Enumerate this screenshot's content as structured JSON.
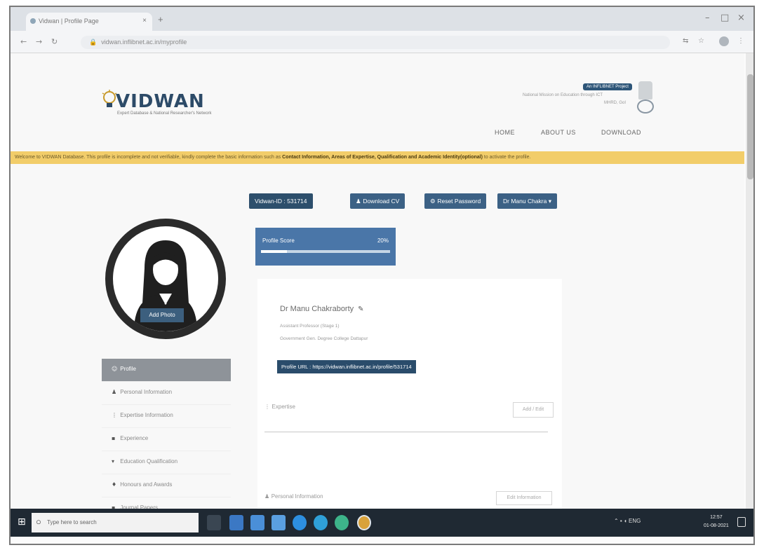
{
  "browser": {
    "tab_title": "Vidwan | Profile Page",
    "url": "vidwan.inflibnet.ac.in/myprofile",
    "win_controls": [
      "–",
      "□",
      "×"
    ],
    "nav_icons": [
      "back-icon",
      "forward-icon",
      "reload-icon",
      "lock-icon"
    ]
  },
  "header": {
    "logo_name": "VIDWAN",
    "logo_tagline": "Expert Database & National Researcher's Network",
    "badge": "An INFLIBNET Project",
    "gov_text": "National Mission on Education through ICT",
    "gov_text2": "MHRD, GoI",
    "nav": [
      "HOME",
      "ABOUT US",
      "DOWNLOAD"
    ]
  },
  "notice": {
    "prefix": "Welcome to VIDWAN Database. This profile is incomplete and not verifiable, kindly complete the basic information such as",
    "highlight": "Contact Information, Areas of Expertise, Qualification and Academic Identity(optional)",
    "suffix": "to activate the profile."
  },
  "actions": {
    "vidwan_id": "Vidwan-ID : 531714",
    "download_cv": "Download CV",
    "reset_password": "Reset Password",
    "user_menu": "Dr Manu Chakra"
  },
  "score": {
    "label": "Profile Score",
    "value": "20%",
    "fraction": 0.2
  },
  "photo": {
    "add_label": "Add Photo"
  },
  "sidebar": {
    "items": [
      {
        "icon": "profile-icon",
        "glyph": "☺",
        "label": "Profile",
        "active": true
      },
      {
        "icon": "user-icon",
        "glyph": "♟",
        "label": "Personal Information"
      },
      {
        "icon": "expertise-icon",
        "glyph": "⋮",
        "label": "Expertise Information"
      },
      {
        "icon": "experience-icon",
        "glyph": "▪",
        "label": "Experience"
      },
      {
        "icon": "qualification-icon",
        "glyph": "▾",
        "label": "Education Qualification"
      },
      {
        "icon": "awards-icon",
        "glyph": "♦",
        "label": "Honours and Awards"
      },
      {
        "icon": "journal-icon",
        "glyph": "▪",
        "label": "Journal Papers"
      }
    ]
  },
  "profile": {
    "name": "Dr Manu Chakraborty",
    "designation": "Assistant Professor (Stage 1)",
    "institution": "Government Gen. Degree College Dattapur",
    "url_label": "Profile URL : https://vidwan.inflibnet.ac.in/profile/531714",
    "expertise_label": "Expertise",
    "expertise_btn": "Add / Edit",
    "personal_label": "Personal Information",
    "personal_btn": "Edit Information"
  },
  "taskbar": {
    "search_placeholder": "Type here to search",
    "tray_text": "ENG",
    "time": "12:57",
    "date": "01-08-2021"
  },
  "colors": {
    "primary": "#2d4f6c",
    "score_panel": "#4a76a8",
    "notice": "#f2cd6a",
    "taskbar": "#1f2933"
  }
}
